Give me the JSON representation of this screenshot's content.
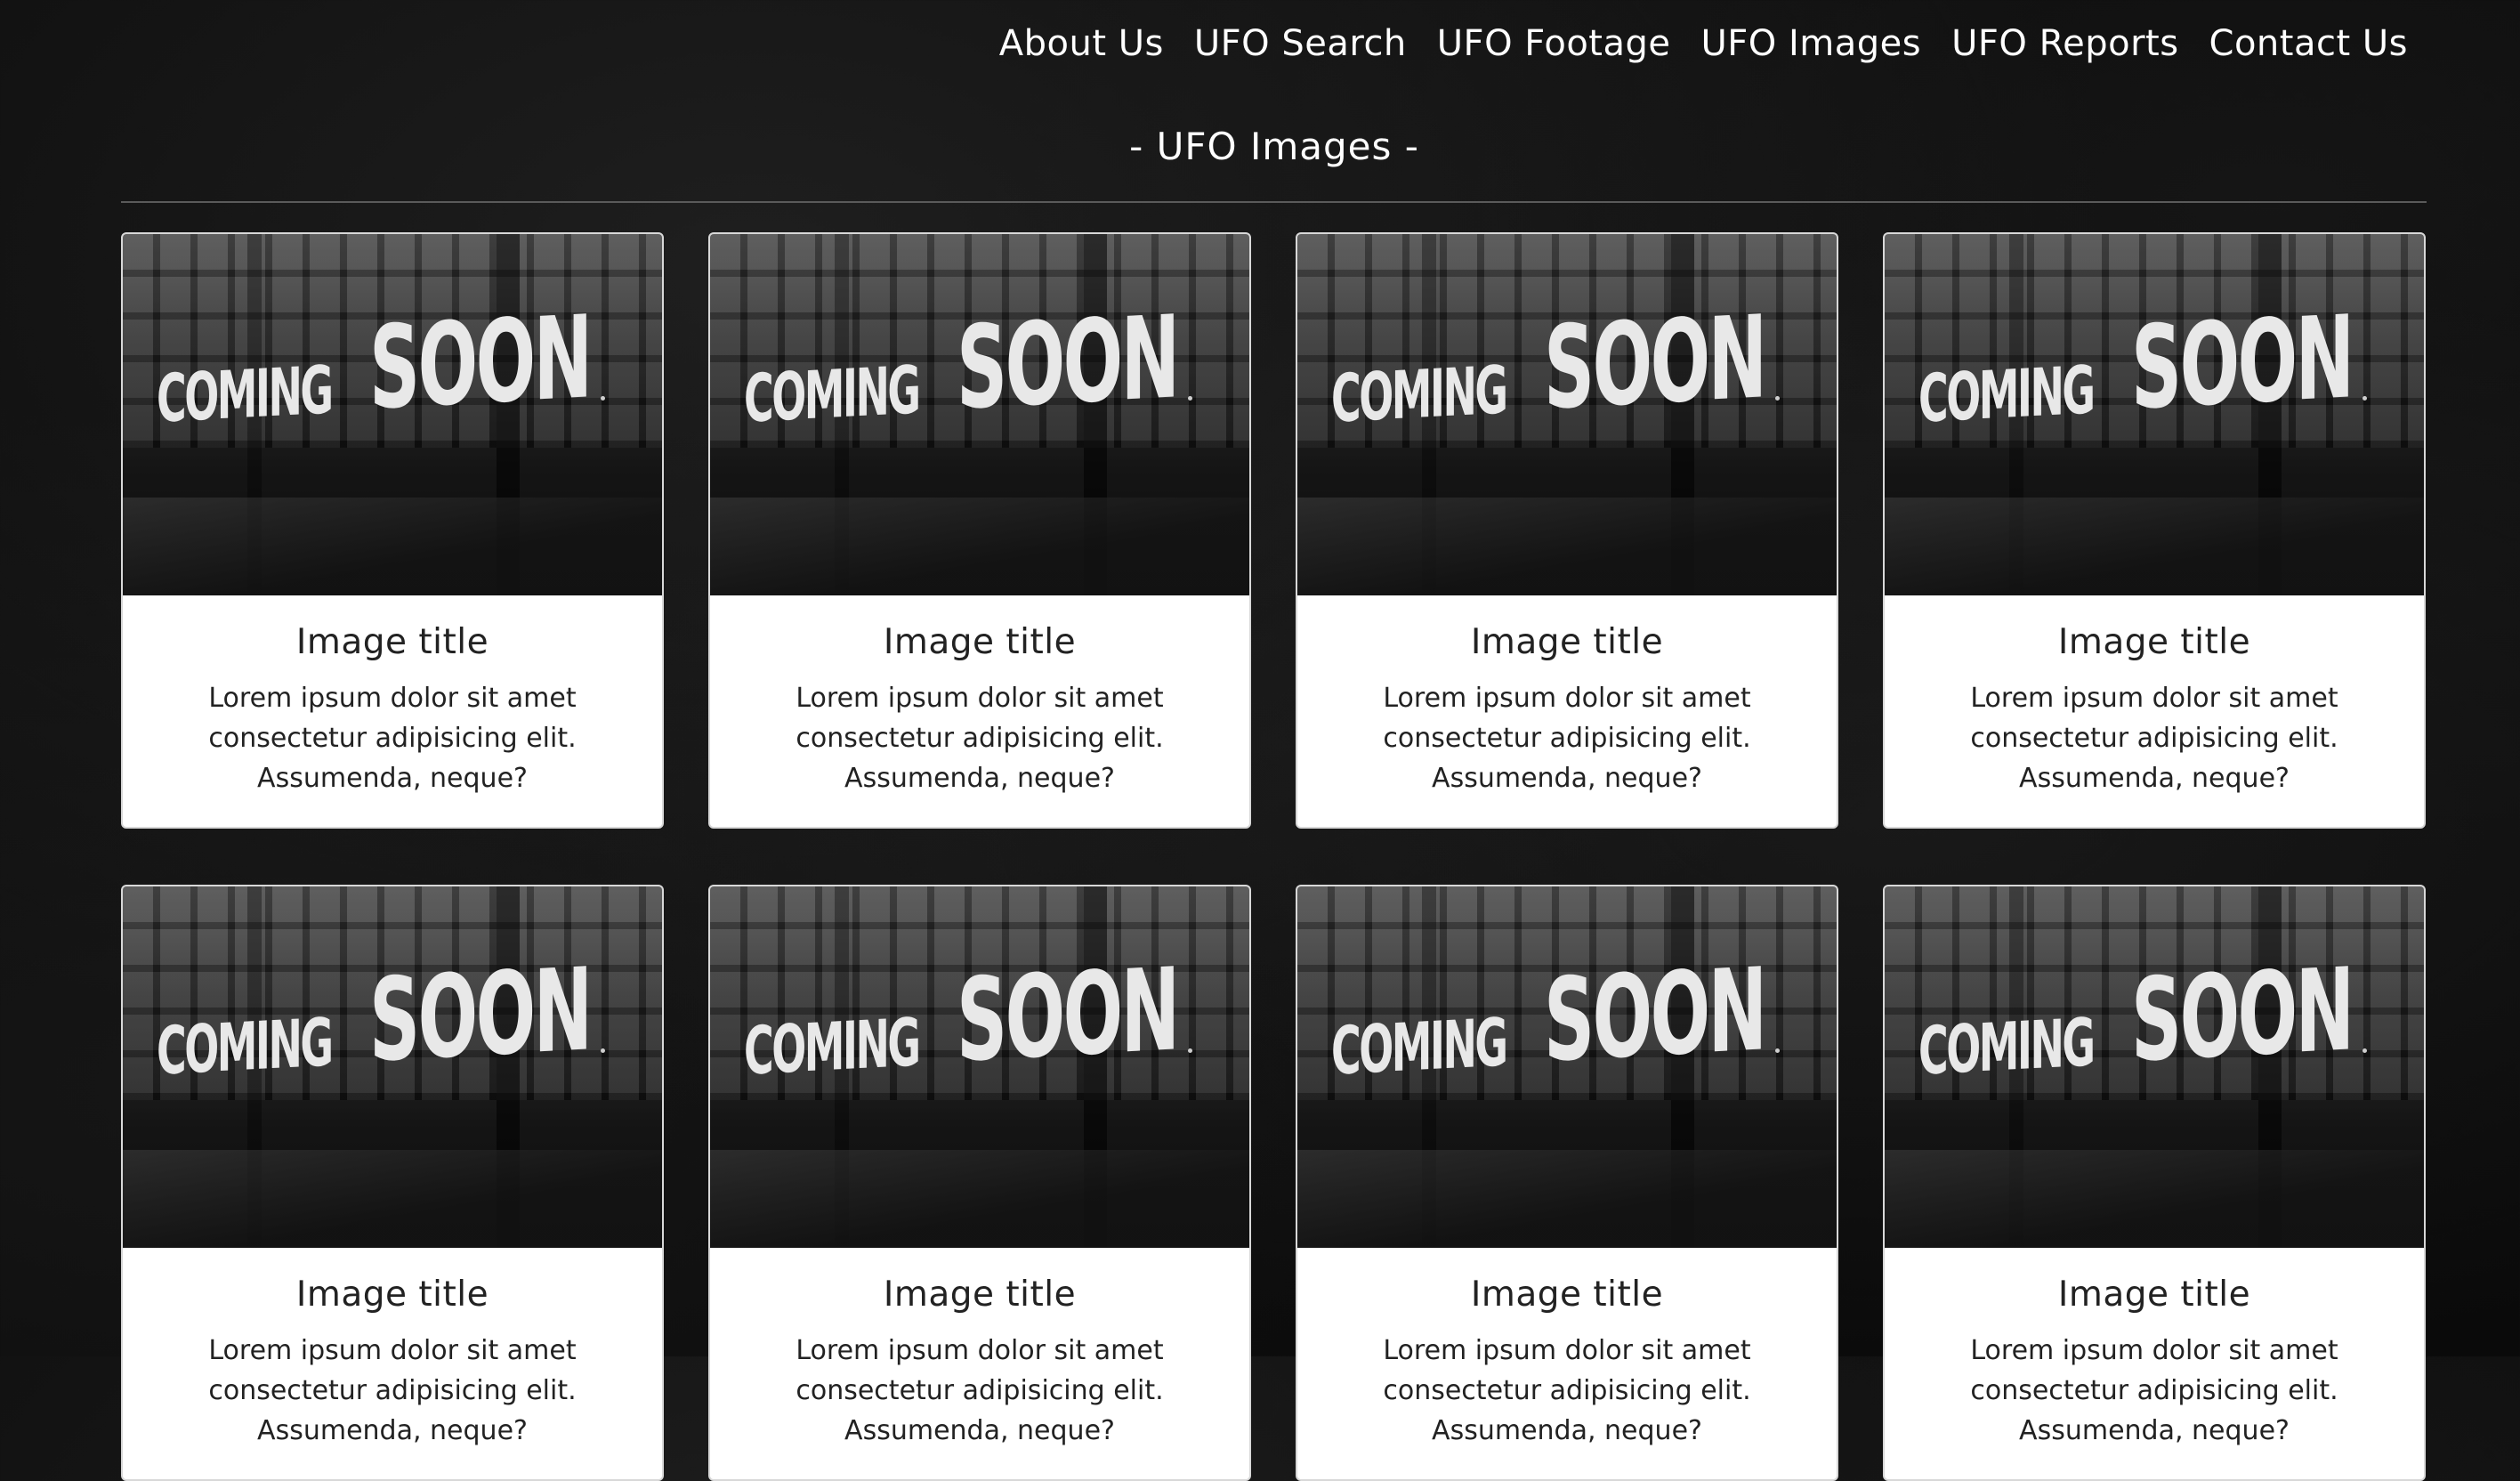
{
  "nav": {
    "items": [
      "About Us",
      "UFO Search",
      "UFO Footage",
      "UFO Images",
      "UFO Reports",
      "Contact Us"
    ]
  },
  "page": {
    "title": "- UFO Images -"
  },
  "cards": [
    {
      "image_text": [
        "COMING",
        "SOON"
      ],
      "title": "Image title",
      "text": "Lorem ipsum dolor sit amet consectetur adipisicing elit. Assumenda, neque?"
    },
    {
      "image_text": [
        "COMING",
        "SOON"
      ],
      "title": "Image title",
      "text": "Lorem ipsum dolor sit amet consectetur adipisicing elit. Assumenda, neque?"
    },
    {
      "image_text": [
        "COMING",
        "SOON"
      ],
      "title": "Image title",
      "text": "Lorem ipsum dolor sit amet consectetur adipisicing elit. Assumenda, neque?"
    },
    {
      "image_text": [
        "COMING",
        "SOON"
      ],
      "title": "Image title",
      "text": "Lorem ipsum dolor sit amet consectetur adipisicing elit. Assumenda, neque?"
    },
    {
      "image_text": [
        "COMING",
        "SOON"
      ],
      "title": "Image title",
      "text": "Lorem ipsum dolor sit amet consectetur adipisicing elit. Assumenda, neque?"
    },
    {
      "image_text": [
        "COMING",
        "SOON"
      ],
      "title": "Image title",
      "text": "Lorem ipsum dolor sit amet consectetur adipisicing elit. Assumenda, neque?"
    },
    {
      "image_text": [
        "COMING",
        "SOON"
      ],
      "title": "Image title",
      "text": "Lorem ipsum dolor sit amet consectetur adipisicing elit. Assumenda, neque?"
    },
    {
      "image_text": [
        "COMING",
        "SOON"
      ],
      "title": "Image title",
      "text": "Lorem ipsum dolor sit amet consectetur adipisicing elit. Assumenda, neque?"
    }
  ]
}
